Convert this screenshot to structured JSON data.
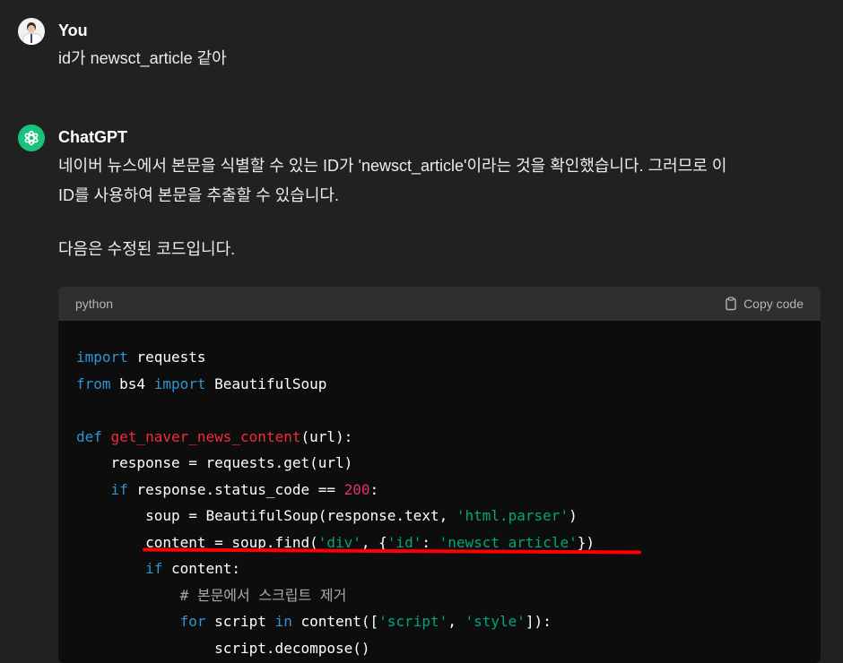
{
  "user_message": {
    "author": "You",
    "text": "id가 newsct_article 같아"
  },
  "assistant_message": {
    "author": "ChatGPT",
    "paragraph1_line1": "네이버 뉴스에서 본문을 식별할 수 있는 ID가 'newsct_article'이라는 것을 확인했습니다. 그러므로 이",
    "paragraph1_line2": "ID를 사용하여 본문을 추출할 수 있습니다.",
    "paragraph2": "다음은 수정된 코드입니다."
  },
  "code_block": {
    "language": "python",
    "copy_label": "Copy code",
    "lines": [
      "import requests",
      "from bs4 import BeautifulSoup",
      "",
      "def get_naver_news_content(url):",
      "    response = requests.get(url)",
      "    if response.status_code == 200:",
      "        soup = BeautifulSoup(response.text, 'html.parser')",
      "        content = soup.find('div', {'id': 'newsct_article'})",
      "        if content:",
      "            # 본문에서 스크립트 제거",
      "            for script in content(['script', 'style']):",
      "                script.decompose()"
    ]
  },
  "annotation": {
    "highlight_color": "#ff0000",
    "highlighted_line": "content = soup.find('div', {'id': 'newsct_article'})"
  },
  "colors": {
    "background": "#212121",
    "code_background": "#0d0d0d",
    "code_header": "#2f2f2f",
    "keyword": "#2e95d3",
    "function_name": "#f22c3d",
    "string": "#00a67d",
    "number": "#df3079",
    "comment": "#a9a9a9",
    "gpt_avatar": "#19c37d"
  },
  "icons": {
    "user_avatar": "user-avatar",
    "gpt_avatar": "openai-logo-icon",
    "copy": "clipboard-icon"
  }
}
